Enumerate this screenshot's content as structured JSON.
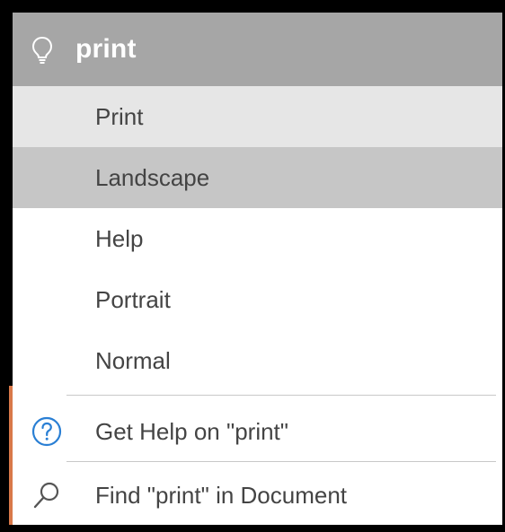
{
  "search": {
    "query": "print",
    "icon": "lightbulb-icon"
  },
  "results": [
    {
      "label": "Print"
    },
    {
      "label": "Landscape"
    },
    {
      "label": "Help"
    },
    {
      "label": "Portrait"
    },
    {
      "label": "Normal"
    }
  ],
  "actions": {
    "get_help": {
      "label": "Get Help on \"print\"",
      "icon": "help-circle-icon"
    },
    "find": {
      "label": "Find \"print\" in Document",
      "icon": "search-icon"
    }
  },
  "colors": {
    "search_bar": "#a6a6a6",
    "hover_item": "#e6e6e6",
    "selected_item": "#c6c6c6",
    "help_icon": "#2a7fd4"
  }
}
